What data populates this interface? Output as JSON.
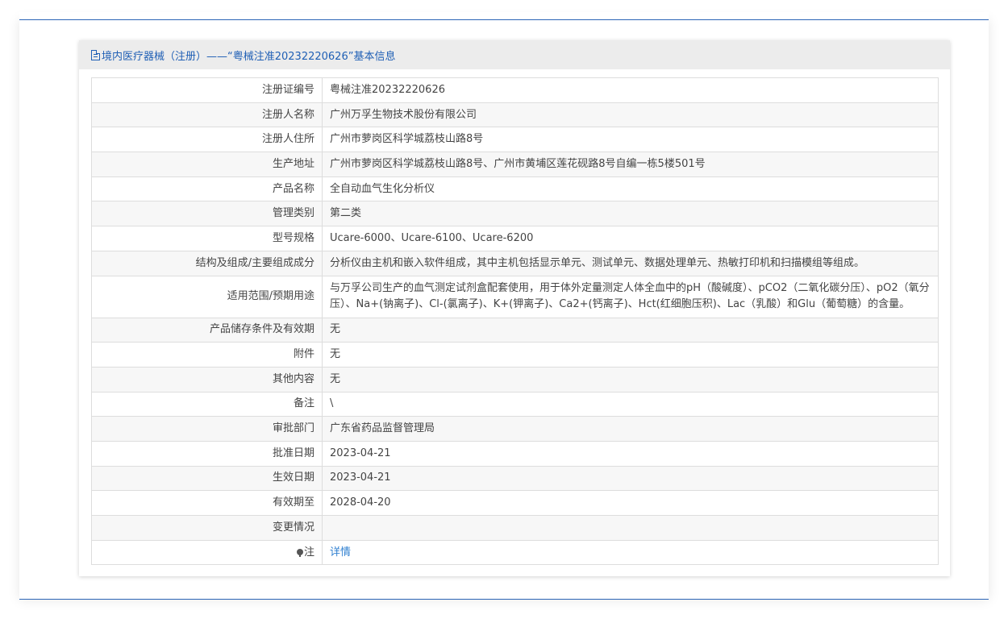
{
  "header": {
    "title": "境内医疗器械（注册）——“粤械注准20232220626”基本信息"
  },
  "rows": [
    {
      "label": "注册证编号",
      "value": "粤械注准20232220626"
    },
    {
      "label": "注册人名称",
      "value": "广州万孚生物技术股份有限公司"
    },
    {
      "label": "注册人住所",
      "value": "广州市萝岗区科学城荔枝山路8号"
    },
    {
      "label": "生产地址",
      "value": "广州市萝岗区科学城荔枝山路8号、广州市黄埔区莲花砚路8号自编一栋5楼501号"
    },
    {
      "label": "产品名称",
      "value": "全自动血气生化分析仪"
    },
    {
      "label": "管理类别",
      "value": "第二类"
    },
    {
      "label": "型号规格",
      "value": "Ucare-6000、Ucare-6100、Ucare-6200"
    },
    {
      "label": "结构及组成/主要组成成分",
      "value": "分析仪由主机和嵌入软件组成，其中主机包括显示单元、测试单元、数据处理单元、热敏打印机和扫描模组等组成。"
    },
    {
      "label": "适用范围/预期用途",
      "value": "与万孚公司生产的血气测定试剂盒配套使用，用于体外定量测定人体全血中的pH（酸碱度）、pCO2（二氧化碳分压）、pO2（氧分压）、Na+(钠离子)、Cl-(氯离子)、K+(钾离子)、Ca2+(钙离子)、Hct(红细胞压积)、Lac（乳酸）和Glu（葡萄糖）的含量。"
    },
    {
      "label": "产品储存条件及有效期",
      "value": "无"
    },
    {
      "label": "附件",
      "value": "无"
    },
    {
      "label": "其他内容",
      "value": "无"
    },
    {
      "label": "备注",
      "value": "\\"
    },
    {
      "label": "审批部门",
      "value": "广东省药品监督管理局"
    },
    {
      "label": "批准日期",
      "value": "2023-04-21"
    },
    {
      "label": "生效日期",
      "value": "2023-04-21"
    },
    {
      "label": "有效期至",
      "value": "2028-04-20"
    },
    {
      "label": "变更情况",
      "value": ""
    }
  ],
  "note": {
    "label": "注",
    "link": "详情"
  },
  "colors": {
    "accent": "#1f5fb5",
    "link": "#2f7fd0",
    "header_bg": "#ececec"
  }
}
